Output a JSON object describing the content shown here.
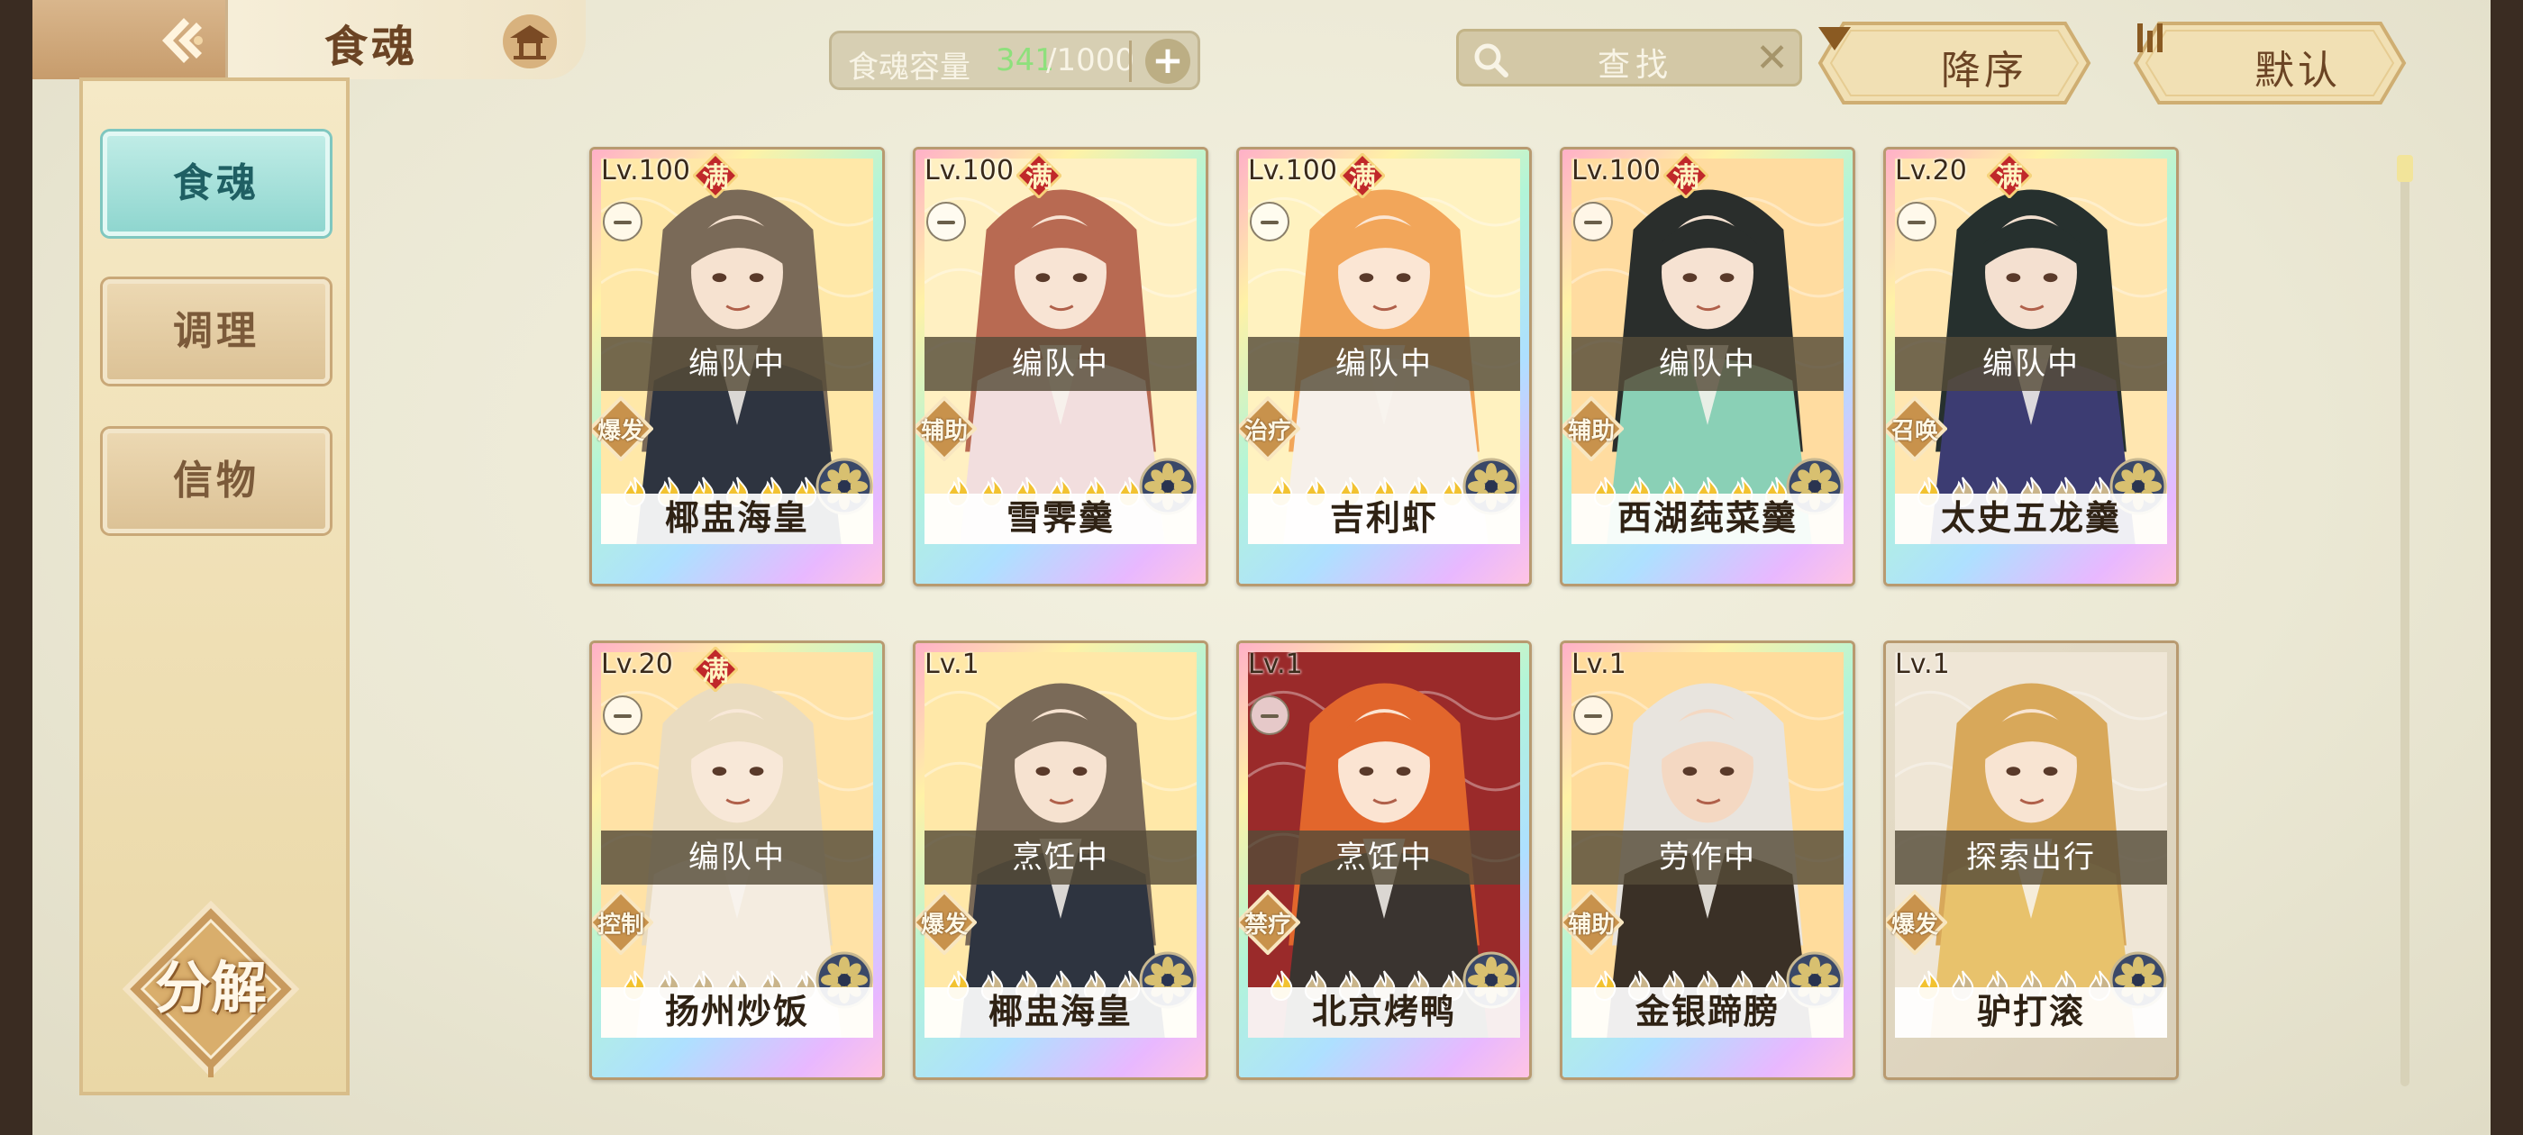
{
  "header": {
    "title": "食魂",
    "capacity_label": "食魂容量",
    "capacity_current": "341",
    "capacity_max": "/1000",
    "capacity_add": "+",
    "search_placeholder": "查找",
    "search_clear": "✕",
    "sort_order_label": "降序",
    "sort_mode_label": "默认"
  },
  "sidebar": {
    "tabs": [
      {
        "label": "食魂",
        "active": true
      },
      {
        "label": "调理",
        "active": false
      },
      {
        "label": "信物",
        "active": false
      }
    ],
    "decompose_label": "分解"
  },
  "cards": [
    {
      "level": "Lv.100",
      "full": "满",
      "status": "编队中",
      "role": "爆发",
      "stars_lit": 6,
      "name": "椰盅海皇",
      "palette": "rainbow",
      "hair": "#7a6a58",
      "face": "#f6e2d0",
      "robe": "#2e3440",
      "bg": "#ffe8a8"
    },
    {
      "level": "Lv.100",
      "full": "满",
      "status": "编队中",
      "role": "辅助",
      "stars_lit": 6,
      "name": "雪霁羹",
      "palette": "rainbow",
      "hair": "#b86a52",
      "face": "#f8e4d4",
      "robe": "#f2dede",
      "bg": "#fff0c2"
    },
    {
      "level": "Lv.100",
      "full": "满",
      "status": "编队中",
      "role": "治疗",
      "stars_lit": 6,
      "name": "吉利虾",
      "palette": "rainbow",
      "hair": "#f2a65a",
      "face": "#fbe6d4",
      "robe": "#f6f0ea",
      "bg": "#fff2c0"
    },
    {
      "level": "Lv.100",
      "full": "满",
      "status": "编队中",
      "role": "辅助",
      "stars_lit": 6,
      "name": "西湖莼菜羹",
      "palette": "rainbow",
      "hair": "#2a2e2c",
      "face": "#f6e2d2",
      "robe": "#8ad0b6",
      "bg": "#ffdca0"
    },
    {
      "level": "Lv.20",
      "full": "满",
      "status": "编队中",
      "role": "召唤",
      "stars_lit": 1,
      "name": "太史五龙羹",
      "palette": "rainbow",
      "hair": "#26302e",
      "face": "#f4e0d0",
      "robe": "#3c3c72",
      "bg": "#ffe6b0"
    },
    {
      "level": "Lv.20",
      "full": "满",
      "status": "编队中",
      "role": "控制",
      "stars_lit": 1,
      "name": "扬州炒饭",
      "palette": "rainbow",
      "hair": "#eadcc0",
      "face": "#f8e8d8",
      "robe": "#f4ece0",
      "bg": "#ffe2a6"
    },
    {
      "level": "Lv.1",
      "full": "",
      "status": "烹饪中",
      "role": "爆发",
      "stars_lit": 1,
      "name": "椰盅海皇",
      "palette": "rainbow",
      "hair": "#7a6a58",
      "face": "#f6e2d0",
      "robe": "#2e3440",
      "bg": "#ffe8a8"
    },
    {
      "level": "Lv.1",
      "full": "",
      "status": "烹饪中",
      "role": "禁疗",
      "stars_lit": 1,
      "name": "北京烤鸭",
      "palette": "rainbow",
      "hair": "#e2662c",
      "face": "#fbe4d2",
      "robe": "#3a3430",
      "bg": "#9a2a2a"
    },
    {
      "level": "Lv.1",
      "full": "",
      "status": "劳作中",
      "role": "辅助",
      "stars_lit": 1,
      "name": "金银蹄膀",
      "palette": "rainbow",
      "hair": "#e8e4de",
      "face": "#f4d8c2",
      "robe": "#3a3026",
      "bg": "#ffdc9c"
    },
    {
      "level": "Lv.1",
      "full": "",
      "status": "探索出行",
      "role": "爆发",
      "stars_lit": 1,
      "name": "驴打滚",
      "palette": "plain",
      "hair": "#d8a85a",
      "face": "#f8e4d2",
      "robe": "#e8c26c",
      "bg": "#efe6d6"
    }
  ],
  "colors": {
    "accent_teal": "#8fd6cf",
    "panel_tan": "#ead7a6",
    "capacity_green": "#8ee07c",
    "star_gold": "#f2c230",
    "star_dim": "#c9b48a",
    "full_badge_red": "#c0282a"
  },
  "icons": {
    "back": "back-arrow-icon",
    "home": "pavilion-home-icon",
    "search": "magnifier-icon",
    "sort_order": "triangle-down-icon",
    "sort_mode": "bars-icon",
    "element": "element-flower-icon",
    "star": "flame-star-icon"
  }
}
